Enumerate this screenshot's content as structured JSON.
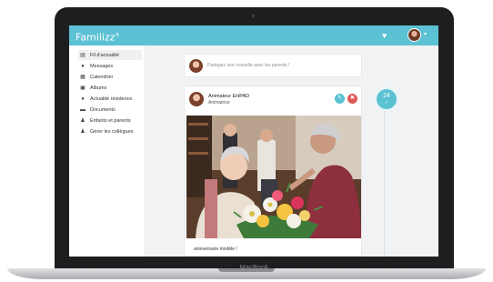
{
  "device": {
    "label": "MacBook"
  },
  "app": {
    "brand": "Familizz",
    "brand_mark": "®"
  },
  "header": {
    "heart_icon": "heart-icon",
    "avatar_icon": "user-avatar",
    "caret": "▾"
  },
  "sidebar": {
    "items": [
      {
        "label": "Fil d'actualité",
        "icon": "▤",
        "active": true
      },
      {
        "label": "Messages",
        "icon": "●",
        "active": false
      },
      {
        "label": "Calendrier",
        "icon": "▦",
        "active": false
      },
      {
        "label": "Albums",
        "icon": "▣",
        "active": false
      },
      {
        "label": "Actualité résidence",
        "icon": "●",
        "active": false
      },
      {
        "label": "Documents",
        "icon": "▬",
        "active": false
      },
      {
        "label": "Enfants et parents",
        "icon": "♟",
        "active": false
      },
      {
        "label": "Gérer les collègues",
        "icon": "♟",
        "active": false
      }
    ]
  },
  "composer": {
    "placeholder": "Partagez une nouvelle avec les parents !"
  },
  "post": {
    "author": "Animateur EHPAD",
    "role": "Animatrice",
    "edit_icon": "✎",
    "delete_icon": "🗑",
    "caption": "anniversaire modèle !"
  },
  "timeline": {
    "day": "24",
    "mark": "✓"
  },
  "colors": {
    "accent": "#5bc1d3",
    "delete": "#e05a5a",
    "background": "#f4f5f6"
  }
}
